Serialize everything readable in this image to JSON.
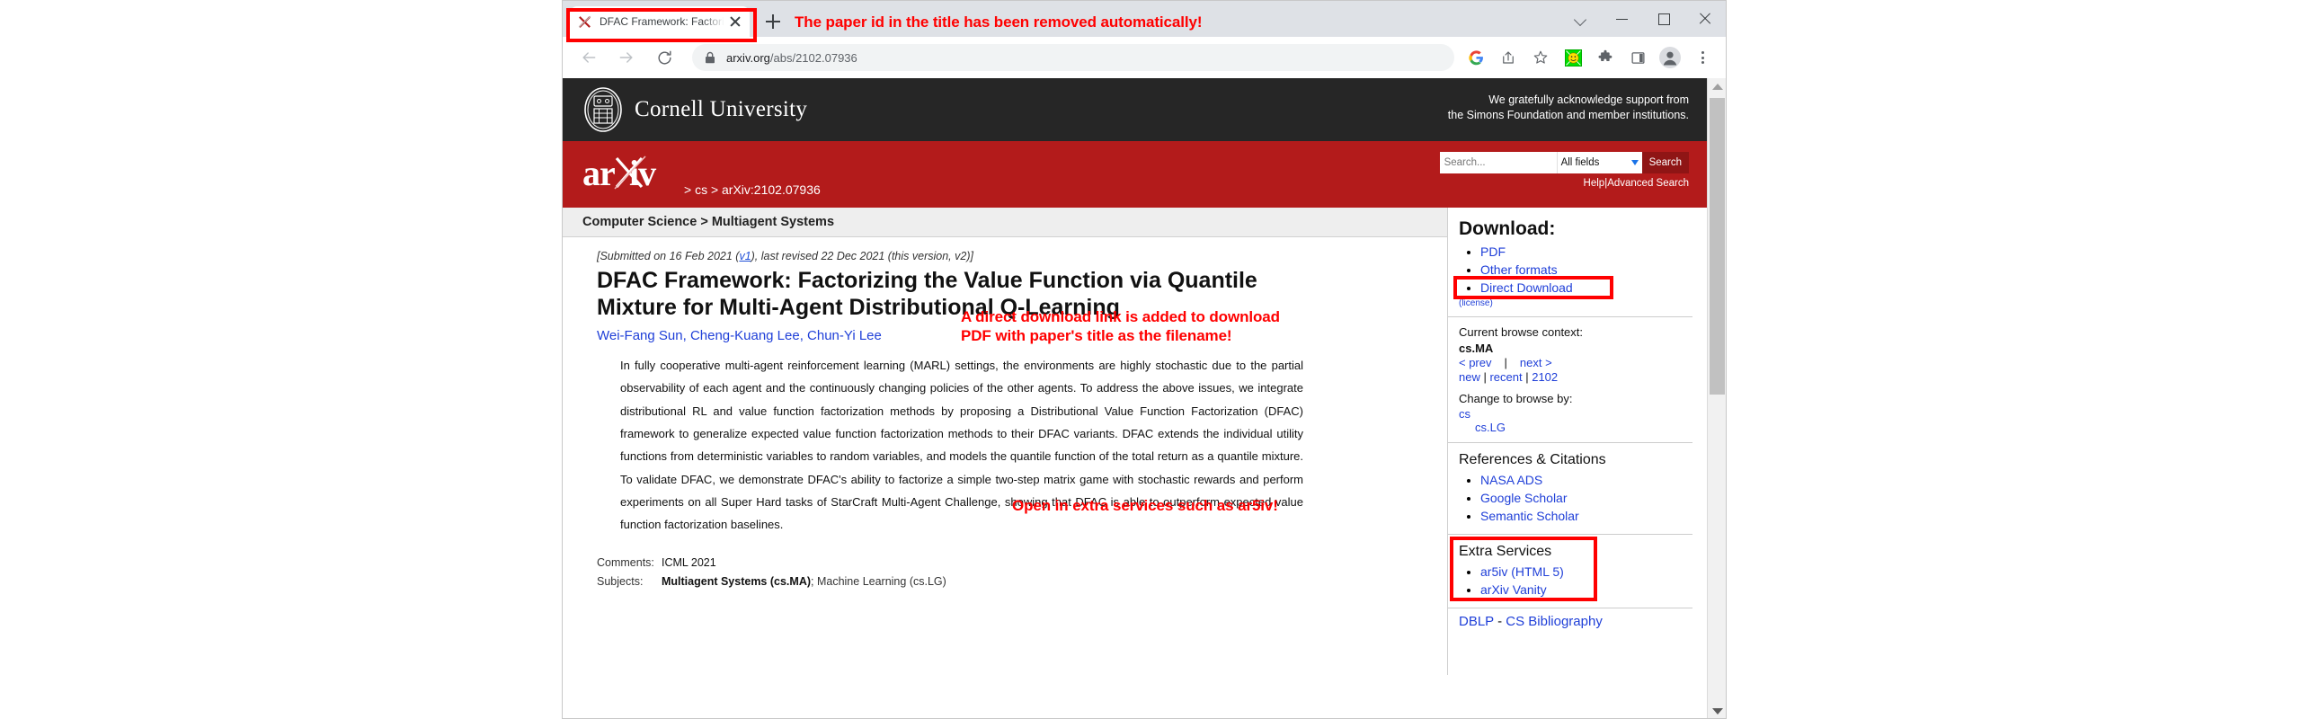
{
  "browser": {
    "tab": {
      "title": "DFAC Framework: Factorizing the",
      "favicon_name": "arxiv-favicon",
      "close_label": "×"
    },
    "new_tab_label": "+",
    "tab_annotation": "The paper id in the title has been removed automatically!",
    "window_controls": {
      "chevron": "v",
      "minimize": "–",
      "maximize": "□",
      "close": "X"
    },
    "toolbar": {
      "back": "←",
      "forward": "→",
      "reload": "⟳",
      "url_domain": "arxiv.org",
      "url_path": "/abs/2102.07936",
      "url_full": "arxiv.org/abs/2102.07936",
      "icons": [
        "google-icon",
        "share-icon",
        "bookmark-star-icon",
        "smiley-extension-icon",
        "puzzle-extensions-icon",
        "sidepanel-icon",
        "profile-avatar-icon",
        "three-dot-menu-icon"
      ]
    }
  },
  "cornell": {
    "name": "Cornell University",
    "ack_line1": "We gratefully acknowledge support from",
    "ack_line2": "the Simons Foundation and member institutions."
  },
  "arxiv_header": {
    "logo_text": "arXiv",
    "breadcrumb": "> cs > arXiv:2102.07936",
    "search_placeholder": "Search...",
    "search_field_selected": "All fields",
    "search_button": "Search",
    "help_link": "Help",
    "separator": "|",
    "advanced_search_link": "Advanced Search"
  },
  "paper": {
    "subject_bar": "Computer Science > Multiagent Systems",
    "submitted_prefix": "[Submitted on 16 Feb 2021 (",
    "submitted_v1": "v1",
    "submitted_mid": "), last revised 22 Dec 2021 (this version, ",
    "submitted_v2": "v2",
    "submitted_suffix": ")]",
    "title": "DFAC Framework: Factorizing the Value Function via Quantile Mixture for Multi-Agent Distributional Q-Learning",
    "authors": "Wei-Fang Sun, Cheng-Kuang Lee, Chun-Yi Lee",
    "abstract": "In fully cooperative multi-agent reinforcement learning (MARL) settings, the environments are highly stochastic due to the partial observability of each agent and the continuously changing policies of the other agents. To address the above issues, we integrate distributional RL and value function factorization methods by proposing a Distributional Value Function Factorization (DFAC) framework to generalize expected value function factorization methods to their DFAC variants. DFAC extends the individual utility functions from deterministic variables to random variables, and models the quantile function of the total return as a quantile mixture. To validate DFAC, we demonstrate DFAC's ability to factorize a simple two-step matrix game with stochastic rewards and perform experiments on all Super Hard tasks of StarCraft Multi-Agent Challenge, showing that DFAC is able to outperform expected value function factorization baselines.",
    "comments_label": "Comments:",
    "comments_value": "ICML 2021",
    "subjects_label": "Subjects:",
    "subjects_primary": "Multiagent Systems (cs.MA)",
    "subjects_sep": "; ",
    "subjects_secondary": "Machine Learning (cs.LG)"
  },
  "annotations": {
    "direct_download": "A direct download link is added to download\nPDF with paper's title as the filename!",
    "ar5iv": "Open in extra services such as ar5iv!"
  },
  "sidebar": {
    "download_heading": "Download:",
    "download_items": [
      "PDF",
      "Other formats",
      "Direct Download"
    ],
    "license": "(license)",
    "browse_context_label": "Current browse context:",
    "browse_context_value": "cs.MA",
    "prev_link": "< prev",
    "nav_sep": "|",
    "next_link": "next >",
    "new_link": "new",
    "recent_link": "recent",
    "archive_link": "2102",
    "change_browse_label": "Change to browse by:",
    "change_browse_primary": "cs",
    "change_browse_secondary": "cs.LG",
    "refs_heading": "References & Citations",
    "refs_items": [
      "NASA ADS",
      "Google Scholar",
      "Semantic Scholar"
    ],
    "extra_heading": "Extra Services",
    "extra_items": [
      "ar5iv (HTML 5)",
      "arXiv Vanity"
    ],
    "dblp_text": "DBLP",
    "dblp_dash": " - ",
    "dblp_suffix": "CS Bibliography"
  },
  "colors": {
    "arxiv_red": "#b31b1b",
    "cornell_dark": "#262626",
    "link_blue": "#1f3fd8",
    "annotation_red": "#ff0000",
    "chrome_tabstrip": "#dee1e6"
  }
}
